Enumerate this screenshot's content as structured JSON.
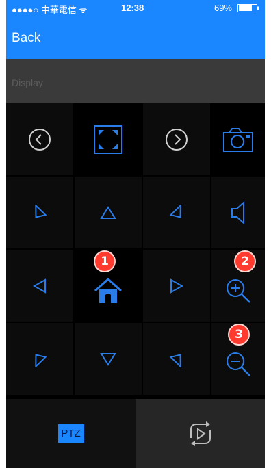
{
  "status_bar": {
    "carrier": "●●●●○ 中華電信 ᯤ",
    "time": "12:38",
    "battery": "69%"
  },
  "nav": {
    "back_label": "Back"
  },
  "display_bar": {
    "label": "Display"
  },
  "controls": {
    "row1": [
      "previous-icon",
      "fullscreen-icon",
      "next-icon",
      "snapshot-icon"
    ],
    "row2": [
      "pan-down-right-icon",
      "pan-up-icon",
      "pan-down-left-icon",
      "speaker-icon"
    ],
    "row3": [
      "pan-left-icon",
      "home-icon",
      "pan-right-icon",
      "zoom-in-icon"
    ],
    "row4": [
      "pan-up-right-icon",
      "pan-down-icon",
      "pan-up-left-icon",
      "zoom-out-icon"
    ]
  },
  "badges": {
    "home": "1",
    "zoom_in": "2",
    "zoom_out": "3"
  },
  "bottom_tabs": {
    "ptz_label": "PTZ",
    "loop_icon": "loop-playback-icon"
  },
  "colors": {
    "accent": "#1a86ff",
    "icon": "#2a7de8",
    "badge": "#ff3b30"
  }
}
